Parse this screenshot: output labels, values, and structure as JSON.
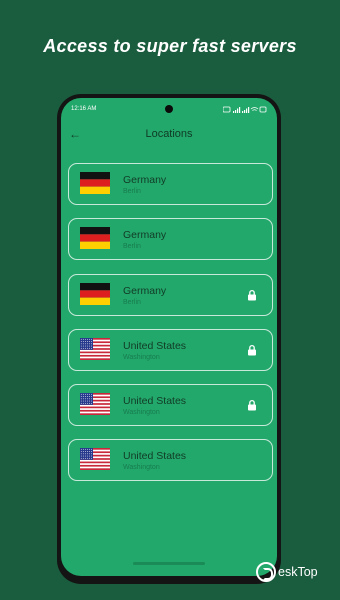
{
  "headline": "Access to super fast servers",
  "status_bar": {
    "time": "12:16 AM",
    "icons": [
      "alarm-icon",
      "signal-icon",
      "signal-icon",
      "wifi-icon",
      "battery-icon"
    ]
  },
  "header": {
    "title": "Locations",
    "back_icon": "back-arrow-icon"
  },
  "locations": [
    {
      "country": "Germany",
      "city": "Berlin",
      "flag": "germany",
      "locked": false
    },
    {
      "country": "Germany",
      "city": "Berlin",
      "flag": "germany",
      "locked": false
    },
    {
      "country": "Germany",
      "city": "Berlin",
      "flag": "germany",
      "locked": true
    },
    {
      "country": "United States",
      "city": "Washington",
      "flag": "usa",
      "locked": true
    },
    {
      "country": "United States",
      "city": "Washington",
      "flag": "usa",
      "locked": true
    },
    {
      "country": "United States",
      "city": "Washington",
      "flag": "usa",
      "locked": false
    }
  ],
  "watermark": {
    "brand": "eskTop"
  },
  "colors": {
    "background": "#1a5c3e",
    "screen": "#23a86b",
    "text_dark": "#113b27"
  }
}
